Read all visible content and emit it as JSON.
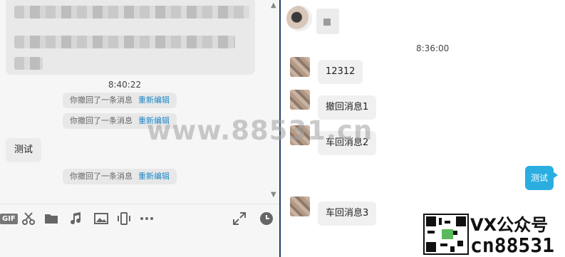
{
  "left_pane": {
    "timestamp": "8:40:22",
    "recall_notices": [
      {
        "text": "你撤回了一条消息",
        "action": "重新编辑"
      },
      {
        "text": "你撤回了一条消息",
        "action": "重新编辑"
      },
      {
        "text": "你撤回了一条消息",
        "action": "重新编辑"
      }
    ],
    "incoming_message": "测试",
    "toolbar": {
      "gif_label": "GIF",
      "items": [
        "gif-icon",
        "scissors-icon",
        "folder-icon",
        "music-icon",
        "image-icon",
        "shake-icon",
        "more-icon",
        "expand-icon",
        "history-icon"
      ]
    }
  },
  "right_pane": {
    "timestamp": "8:36:00",
    "messages": [
      {
        "text": "12312"
      },
      {
        "text": "撤回消息1"
      },
      {
        "text": "车回消息2"
      },
      {
        "text": "车回消息3"
      }
    ],
    "self_message": "测试"
  },
  "watermarks": {
    "center": "www.88531.cn",
    "brand": "VX公众号",
    "id": "cn88531"
  },
  "colors": {
    "link": "#1e88c8",
    "self_bubble": "#2aaee0",
    "divider": "#1f3f6a"
  }
}
